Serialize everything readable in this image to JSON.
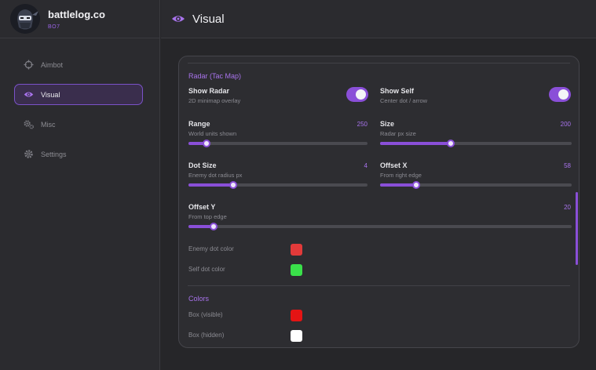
{
  "brand": {
    "name": "battlelog.co",
    "sub": "BO7"
  },
  "nav": [
    {
      "label": "Aimbot",
      "icon": "crosshair-icon",
      "active": false
    },
    {
      "label": "Visual",
      "icon": "eye-icon",
      "active": true
    },
    {
      "label": "Misc",
      "icon": "gears-icon",
      "active": false
    },
    {
      "label": "Settings",
      "icon": "gear-icon",
      "active": false
    }
  ],
  "header": {
    "title": "Visual",
    "icon": "eye-icon"
  },
  "radar": {
    "section_title": "Radar (Tac Map)",
    "show_radar": {
      "label": "Show Radar",
      "sub": "2D minimap overlay",
      "on": true
    },
    "show_self": {
      "label": "Show Self",
      "sub": "Center dot / arrow",
      "on": true
    },
    "range": {
      "label": "Range",
      "sub": "World units shown",
      "value": "250",
      "fraction": 0.1
    },
    "size": {
      "label": "Size",
      "sub": "Radar px size",
      "value": "200",
      "fraction": 0.37
    },
    "dot_size": {
      "label": "Dot Size",
      "sub": "Enemy dot radius px",
      "value": "4",
      "fraction": 0.25
    },
    "offset_x": {
      "label": "Offset X",
      "sub": "From right edge",
      "value": "58",
      "fraction": 0.19
    },
    "offset_y": {
      "label": "Offset Y",
      "sub": "From top edge",
      "value": "20",
      "fraction": 0.066
    },
    "enemy_dot_color": {
      "label": "Enemy dot color",
      "color": "#e23a3a"
    },
    "self_dot_color": {
      "label": "Self dot color",
      "color": "#3ae04a"
    }
  },
  "colors": {
    "section_title": "Colors",
    "box_visible": {
      "label": "Box (visible)",
      "color": "#e41414"
    },
    "box_hidden": {
      "label": "Box (hidden)",
      "color": "#ffffff"
    }
  },
  "theme": {
    "accent": "#8a4fd8",
    "accent_text": "#a873ec",
    "background": "#262629"
  }
}
